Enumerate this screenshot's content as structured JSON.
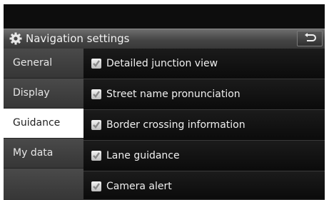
{
  "header": {
    "title": "Navigation settings",
    "icon": "gear-icon",
    "back_icon": "back-arrow-icon"
  },
  "sidebar": {
    "items": [
      {
        "label": "General",
        "selected": false
      },
      {
        "label": "Display",
        "selected": false
      },
      {
        "label": "Guidance",
        "selected": true
      },
      {
        "label": "My data",
        "selected": false
      }
    ]
  },
  "options": [
    {
      "label": "Detailed junction view",
      "checked": true
    },
    {
      "label": "Street name pronunciation",
      "checked": true
    },
    {
      "label": "Border crossing information",
      "checked": true
    },
    {
      "label": "Lane guidance",
      "checked": true
    },
    {
      "label": "Camera alert",
      "checked": true
    }
  ],
  "colors": {
    "selected_tab_bg": "#ffffff",
    "panel_bg": "#0d0d0d",
    "header_bg": "#4a4a4a"
  }
}
